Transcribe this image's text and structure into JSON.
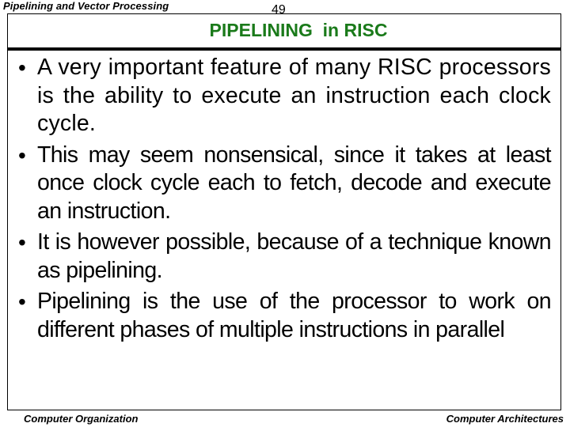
{
  "header": {
    "section_title": "Pipelining and Vector Processing",
    "page_number": "49"
  },
  "slide": {
    "title": "PIPELINING  in RISC",
    "title_color": "#1a7a1a",
    "bullet_symbol": "•",
    "bullets": [
      {
        "text": "A very important feature of many RISC processors is the ability to execute an instruction each clock cycle."
      },
      {
        "text": "This may seem nonsensical, since it takes at least once clock cycle each to fetch, decode and execute an instruction."
      },
      {
        "text": "It is however possible, because of a technique known as pipelining."
      },
      {
        "text": "Pipelining is the use of the processor to work on different phases of multiple instructions in parallel"
      }
    ]
  },
  "footer": {
    "left": "Computer Organization",
    "right": "Computer Architectures"
  }
}
